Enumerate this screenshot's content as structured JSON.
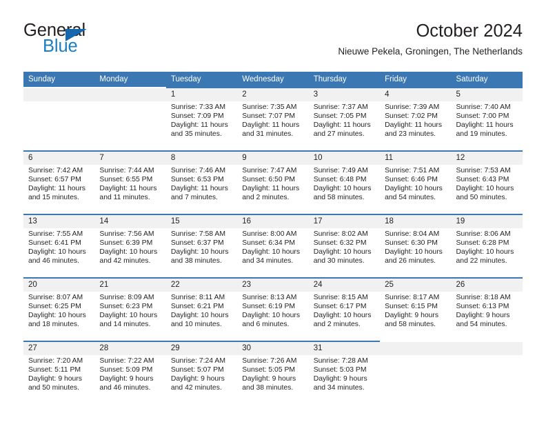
{
  "brand": {
    "word_top": "General",
    "word_bottom": "Blue",
    "triangle_color": "#1668ae",
    "blue_text_color": "#1a7fc1",
    "logo_icon": "triangle-icon"
  },
  "header": {
    "title": "October 2024",
    "subtitle": "Nieuwe Pekela, Groningen, The Netherlands"
  },
  "colors": {
    "header_blue": "#3b77b3",
    "daynum_band": "#f1f1f1",
    "text": "#231f20"
  },
  "weekday_headers": [
    "Sunday",
    "Monday",
    "Tuesday",
    "Wednesday",
    "Thursday",
    "Friday",
    "Saturday"
  ],
  "labels": {
    "sunrise_prefix": "Sunrise:",
    "sunset_prefix": "Sunset:",
    "daylight_prefix": "Daylight:"
  },
  "chart_data": {
    "type": "table",
    "title": "October 2024",
    "subtitle": "Nieuwe Pekela, Groningen, The Netherlands",
    "columns": [
      "Sunday",
      "Monday",
      "Tuesday",
      "Wednesday",
      "Thursday",
      "Friday",
      "Saturday"
    ],
    "days": [
      {
        "day": 1,
        "sunrise": "7:33 AM",
        "sunset": "7:09 PM",
        "daylight_hours": 11,
        "daylight_minutes": 35
      },
      {
        "day": 2,
        "sunrise": "7:35 AM",
        "sunset": "7:07 PM",
        "daylight_hours": 11,
        "daylight_minutes": 31
      },
      {
        "day": 3,
        "sunrise": "7:37 AM",
        "sunset": "7:05 PM",
        "daylight_hours": 11,
        "daylight_minutes": 27
      },
      {
        "day": 4,
        "sunrise": "7:39 AM",
        "sunset": "7:02 PM",
        "daylight_hours": 11,
        "daylight_minutes": 23
      },
      {
        "day": 5,
        "sunrise": "7:40 AM",
        "sunset": "7:00 PM",
        "daylight_hours": 11,
        "daylight_minutes": 19
      },
      {
        "day": 6,
        "sunrise": "7:42 AM",
        "sunset": "6:57 PM",
        "daylight_hours": 11,
        "daylight_minutes": 15
      },
      {
        "day": 7,
        "sunrise": "7:44 AM",
        "sunset": "6:55 PM",
        "daylight_hours": 11,
        "daylight_minutes": 11
      },
      {
        "day": 8,
        "sunrise": "7:46 AM",
        "sunset": "6:53 PM",
        "daylight_hours": 11,
        "daylight_minutes": 7
      },
      {
        "day": 9,
        "sunrise": "7:47 AM",
        "sunset": "6:50 PM",
        "daylight_hours": 11,
        "daylight_minutes": 2
      },
      {
        "day": 10,
        "sunrise": "7:49 AM",
        "sunset": "6:48 PM",
        "daylight_hours": 10,
        "daylight_minutes": 58
      },
      {
        "day": 11,
        "sunrise": "7:51 AM",
        "sunset": "6:46 PM",
        "daylight_hours": 10,
        "daylight_minutes": 54
      },
      {
        "day": 12,
        "sunrise": "7:53 AM",
        "sunset": "6:43 PM",
        "daylight_hours": 10,
        "daylight_minutes": 50
      },
      {
        "day": 13,
        "sunrise": "7:55 AM",
        "sunset": "6:41 PM",
        "daylight_hours": 10,
        "daylight_minutes": 46
      },
      {
        "day": 14,
        "sunrise": "7:56 AM",
        "sunset": "6:39 PM",
        "daylight_hours": 10,
        "daylight_minutes": 42
      },
      {
        "day": 15,
        "sunrise": "7:58 AM",
        "sunset": "6:37 PM",
        "daylight_hours": 10,
        "daylight_minutes": 38
      },
      {
        "day": 16,
        "sunrise": "8:00 AM",
        "sunset": "6:34 PM",
        "daylight_hours": 10,
        "daylight_minutes": 34
      },
      {
        "day": 17,
        "sunrise": "8:02 AM",
        "sunset": "6:32 PM",
        "daylight_hours": 10,
        "daylight_minutes": 30
      },
      {
        "day": 18,
        "sunrise": "8:04 AM",
        "sunset": "6:30 PM",
        "daylight_hours": 10,
        "daylight_minutes": 26
      },
      {
        "day": 19,
        "sunrise": "8:06 AM",
        "sunset": "6:28 PM",
        "daylight_hours": 10,
        "daylight_minutes": 22
      },
      {
        "day": 20,
        "sunrise": "8:07 AM",
        "sunset": "6:25 PM",
        "daylight_hours": 10,
        "daylight_minutes": 18
      },
      {
        "day": 21,
        "sunrise": "8:09 AM",
        "sunset": "6:23 PM",
        "daylight_hours": 10,
        "daylight_minutes": 14
      },
      {
        "day": 22,
        "sunrise": "8:11 AM",
        "sunset": "6:21 PM",
        "daylight_hours": 10,
        "daylight_minutes": 10
      },
      {
        "day": 23,
        "sunrise": "8:13 AM",
        "sunset": "6:19 PM",
        "daylight_hours": 10,
        "daylight_minutes": 6
      },
      {
        "day": 24,
        "sunrise": "8:15 AM",
        "sunset": "6:17 PM",
        "daylight_hours": 10,
        "daylight_minutes": 2
      },
      {
        "day": 25,
        "sunrise": "8:17 AM",
        "sunset": "6:15 PM",
        "daylight_hours": 9,
        "daylight_minutes": 58
      },
      {
        "day": 26,
        "sunrise": "8:18 AM",
        "sunset": "6:13 PM",
        "daylight_hours": 9,
        "daylight_minutes": 54
      },
      {
        "day": 27,
        "sunrise": "7:20 AM",
        "sunset": "5:11 PM",
        "daylight_hours": 9,
        "daylight_minutes": 50
      },
      {
        "day": 28,
        "sunrise": "7:22 AM",
        "sunset": "5:09 PM",
        "daylight_hours": 9,
        "daylight_minutes": 46
      },
      {
        "day": 29,
        "sunrise": "7:24 AM",
        "sunset": "5:07 PM",
        "daylight_hours": 9,
        "daylight_minutes": 42
      },
      {
        "day": 30,
        "sunrise": "7:26 AM",
        "sunset": "5:05 PM",
        "daylight_hours": 9,
        "daylight_minutes": 38
      },
      {
        "day": 31,
        "sunrise": "7:28 AM",
        "sunset": "5:03 PM",
        "daylight_hours": 9,
        "daylight_minutes": 34
      }
    ],
    "leading_blanks": 2,
    "trailing_blanks": 2
  }
}
